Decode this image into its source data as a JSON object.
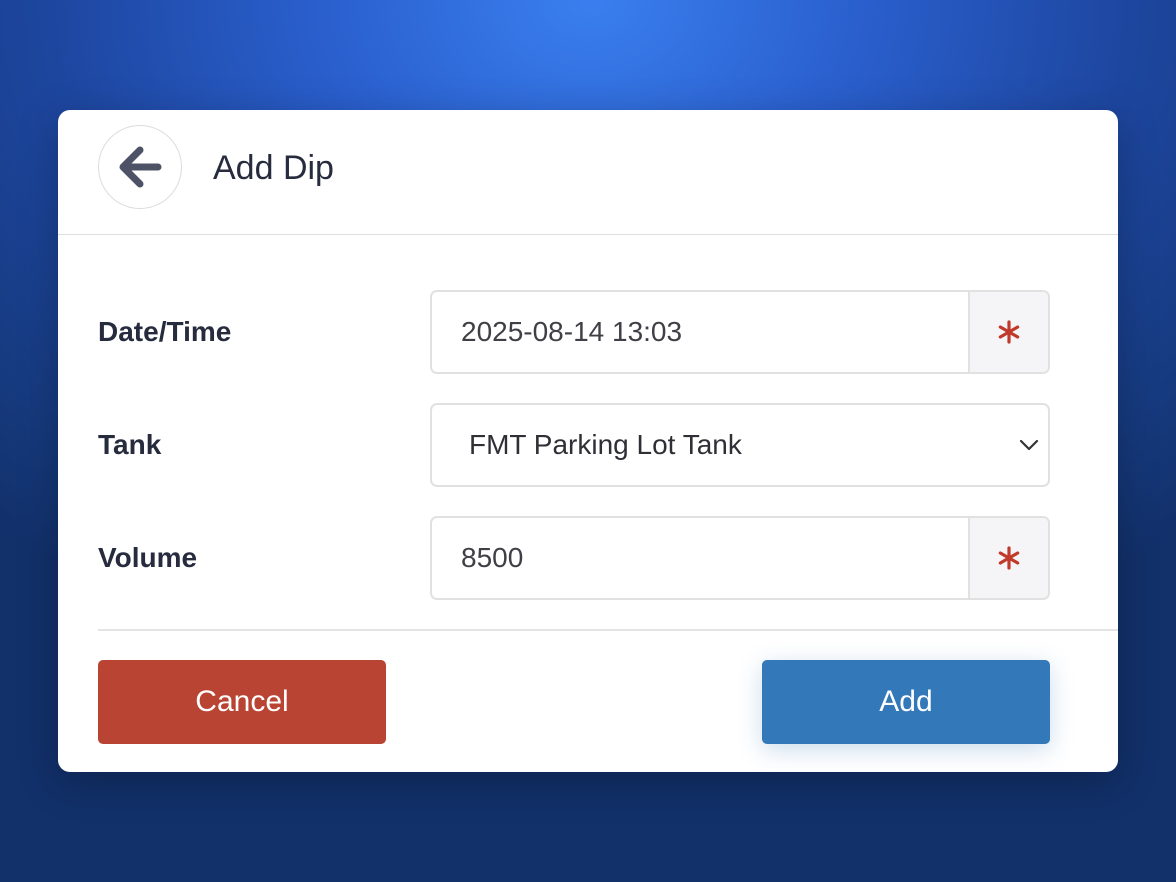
{
  "dialog": {
    "title": "Add Dip"
  },
  "form": {
    "datetime": {
      "label": "Date/Time",
      "value": "2025-08-14 13:03",
      "required_marker": "*"
    },
    "tank": {
      "label": "Tank",
      "selected": "FMT Parking Lot Tank"
    },
    "volume": {
      "label": "Volume",
      "value": "8500",
      "required_marker": "*"
    }
  },
  "actions": {
    "cancel_label": "Cancel",
    "add_label": "Add"
  },
  "colors": {
    "cancel": "#b94433",
    "add": "#3378b9",
    "required": "#c0392b"
  },
  "icons": {
    "back": "arrow-left-icon",
    "dropdown": "chevron-down-icon",
    "required": "asterisk-icon"
  }
}
